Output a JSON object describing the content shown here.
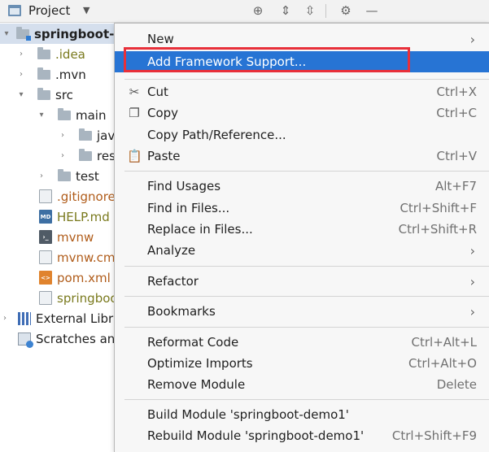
{
  "header": {
    "title": "Project",
    "buttons": [
      "target-icon",
      "expand-all-icon",
      "collapse-all-icon",
      "gear-icon",
      "minimize-icon"
    ]
  },
  "tree": {
    "items": [
      {
        "label": "springboot-d",
        "kind": "module",
        "chevron": "▾"
      },
      {
        "label": ".idea",
        "kind": "folder",
        "chevron": "›"
      },
      {
        "label": ".mvn",
        "kind": "folder",
        "chevron": "›"
      },
      {
        "label": "src",
        "kind": "folder",
        "chevron": "▾"
      },
      {
        "label": "main",
        "kind": "folder",
        "chevron": "▾"
      },
      {
        "label": "jav",
        "kind": "folder",
        "chevron": "›"
      },
      {
        "label": "res",
        "kind": "folder",
        "chevron": "›"
      },
      {
        "label": "test",
        "kind": "folder",
        "chevron": "›"
      },
      {
        "label": ".gitignore",
        "kind": "file"
      },
      {
        "label": "HELP.md",
        "kind": "file",
        "badge": "MD"
      },
      {
        "label": "mvnw",
        "kind": "file",
        "badge": "›_"
      },
      {
        "label": "mvnw.cmd",
        "kind": "file"
      },
      {
        "label": "pom.xml",
        "kind": "file",
        "badge": "<>"
      },
      {
        "label": "springboo",
        "kind": "file"
      },
      {
        "label": "External Libra",
        "kind": "library",
        "chevron": "›"
      },
      {
        "label": "Scratches and",
        "kind": "scratches"
      }
    ]
  },
  "menu": {
    "items": [
      {
        "label": "New",
        "shortcut": "",
        "submenu": true
      },
      {
        "label": "Add Framework Support...",
        "shortcut": "",
        "highlighted": true
      },
      {
        "label": "Cut",
        "shortcut": "Ctrl+X",
        "icon": "scissors-icon"
      },
      {
        "label": "Copy",
        "shortcut": "Ctrl+C",
        "icon": "copy-icon"
      },
      {
        "label": "Copy Path/Reference...",
        "shortcut": ""
      },
      {
        "label": "Paste",
        "shortcut": "Ctrl+V",
        "icon": "clipboard-icon"
      },
      {
        "label": "Find Usages",
        "shortcut": "Alt+F7"
      },
      {
        "label": "Find in Files...",
        "shortcut": "Ctrl+Shift+F"
      },
      {
        "label": "Replace in Files...",
        "shortcut": "Ctrl+Shift+R"
      },
      {
        "label": "Analyze",
        "shortcut": "",
        "submenu": true
      },
      {
        "label": "Refactor",
        "shortcut": "",
        "submenu": true
      },
      {
        "label": "Bookmarks",
        "shortcut": "",
        "submenu": true
      },
      {
        "label": "Reformat Code",
        "shortcut": "Ctrl+Alt+L"
      },
      {
        "label": "Optimize Imports",
        "shortcut": "Ctrl+Alt+O"
      },
      {
        "label": "Remove Module",
        "shortcut": "Delete"
      },
      {
        "label": "Build Module 'springboot-demo1'",
        "shortcut": ""
      },
      {
        "label": "Rebuild Module 'springboot-demo1'",
        "shortcut": "Ctrl+Shift+F9"
      }
    ]
  },
  "colors": {
    "highlight": "#2774d4",
    "annotation_box": "#e8303a",
    "selection": "#d5dfed"
  }
}
